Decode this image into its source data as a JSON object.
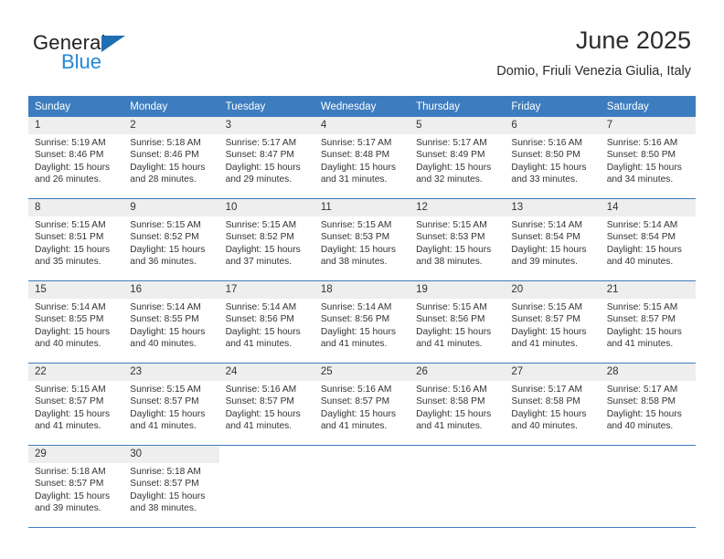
{
  "logo": {
    "word_one": "General",
    "word_two": "Blue",
    "triangle_icon": "triangle-icon",
    "brand_blue": "#2388d6",
    "brand_dark_blue": "#1f6fb4"
  },
  "header": {
    "title": "June 2025",
    "location": "Domio, Friuli Venezia Giulia, Italy"
  },
  "theme": {
    "header_bg": "#3d7dbf",
    "daynum_bg": "#eeeeee",
    "text": "#333333"
  },
  "calendar": {
    "weekdays": [
      "Sunday",
      "Monday",
      "Tuesday",
      "Wednesday",
      "Thursday",
      "Friday",
      "Saturday"
    ],
    "labels": {
      "sunrise": "Sunrise:",
      "sunset": "Sunset:",
      "daylight": "Daylight:"
    },
    "weeks": [
      [
        {
          "day": "1",
          "sunrise": "Sunrise: 5:19 AM",
          "sunset": "Sunset: 8:46 PM",
          "daylight": "Daylight: 15 hours and 26 minutes."
        },
        {
          "day": "2",
          "sunrise": "Sunrise: 5:18 AM",
          "sunset": "Sunset: 8:46 PM",
          "daylight": "Daylight: 15 hours and 28 minutes."
        },
        {
          "day": "3",
          "sunrise": "Sunrise: 5:17 AM",
          "sunset": "Sunset: 8:47 PM",
          "daylight": "Daylight: 15 hours and 29 minutes."
        },
        {
          "day": "4",
          "sunrise": "Sunrise: 5:17 AM",
          "sunset": "Sunset: 8:48 PM",
          "daylight": "Daylight: 15 hours and 31 minutes."
        },
        {
          "day": "5",
          "sunrise": "Sunrise: 5:17 AM",
          "sunset": "Sunset: 8:49 PM",
          "daylight": "Daylight: 15 hours and 32 minutes."
        },
        {
          "day": "6",
          "sunrise": "Sunrise: 5:16 AM",
          "sunset": "Sunset: 8:50 PM",
          "daylight": "Daylight: 15 hours and 33 minutes."
        },
        {
          "day": "7",
          "sunrise": "Sunrise: 5:16 AM",
          "sunset": "Sunset: 8:50 PM",
          "daylight": "Daylight: 15 hours and 34 minutes."
        }
      ],
      [
        {
          "day": "8",
          "sunrise": "Sunrise: 5:15 AM",
          "sunset": "Sunset: 8:51 PM",
          "daylight": "Daylight: 15 hours and 35 minutes."
        },
        {
          "day": "9",
          "sunrise": "Sunrise: 5:15 AM",
          "sunset": "Sunset: 8:52 PM",
          "daylight": "Daylight: 15 hours and 36 minutes."
        },
        {
          "day": "10",
          "sunrise": "Sunrise: 5:15 AM",
          "sunset": "Sunset: 8:52 PM",
          "daylight": "Daylight: 15 hours and 37 minutes."
        },
        {
          "day": "11",
          "sunrise": "Sunrise: 5:15 AM",
          "sunset": "Sunset: 8:53 PM",
          "daylight": "Daylight: 15 hours and 38 minutes."
        },
        {
          "day": "12",
          "sunrise": "Sunrise: 5:15 AM",
          "sunset": "Sunset: 8:53 PM",
          "daylight": "Daylight: 15 hours and 38 minutes."
        },
        {
          "day": "13",
          "sunrise": "Sunrise: 5:14 AM",
          "sunset": "Sunset: 8:54 PM",
          "daylight": "Daylight: 15 hours and 39 minutes."
        },
        {
          "day": "14",
          "sunrise": "Sunrise: 5:14 AM",
          "sunset": "Sunset: 8:54 PM",
          "daylight": "Daylight: 15 hours and 40 minutes."
        }
      ],
      [
        {
          "day": "15",
          "sunrise": "Sunrise: 5:14 AM",
          "sunset": "Sunset: 8:55 PM",
          "daylight": "Daylight: 15 hours and 40 minutes."
        },
        {
          "day": "16",
          "sunrise": "Sunrise: 5:14 AM",
          "sunset": "Sunset: 8:55 PM",
          "daylight": "Daylight: 15 hours and 40 minutes."
        },
        {
          "day": "17",
          "sunrise": "Sunrise: 5:14 AM",
          "sunset": "Sunset: 8:56 PM",
          "daylight": "Daylight: 15 hours and 41 minutes."
        },
        {
          "day": "18",
          "sunrise": "Sunrise: 5:14 AM",
          "sunset": "Sunset: 8:56 PM",
          "daylight": "Daylight: 15 hours and 41 minutes."
        },
        {
          "day": "19",
          "sunrise": "Sunrise: 5:15 AM",
          "sunset": "Sunset: 8:56 PM",
          "daylight": "Daylight: 15 hours and 41 minutes."
        },
        {
          "day": "20",
          "sunrise": "Sunrise: 5:15 AM",
          "sunset": "Sunset: 8:57 PM",
          "daylight": "Daylight: 15 hours and 41 minutes."
        },
        {
          "day": "21",
          "sunrise": "Sunrise: 5:15 AM",
          "sunset": "Sunset: 8:57 PM",
          "daylight": "Daylight: 15 hours and 41 minutes."
        }
      ],
      [
        {
          "day": "22",
          "sunrise": "Sunrise: 5:15 AM",
          "sunset": "Sunset: 8:57 PM",
          "daylight": "Daylight: 15 hours and 41 minutes."
        },
        {
          "day": "23",
          "sunrise": "Sunrise: 5:15 AM",
          "sunset": "Sunset: 8:57 PM",
          "daylight": "Daylight: 15 hours and 41 minutes."
        },
        {
          "day": "24",
          "sunrise": "Sunrise: 5:16 AM",
          "sunset": "Sunset: 8:57 PM",
          "daylight": "Daylight: 15 hours and 41 minutes."
        },
        {
          "day": "25",
          "sunrise": "Sunrise: 5:16 AM",
          "sunset": "Sunset: 8:57 PM",
          "daylight": "Daylight: 15 hours and 41 minutes."
        },
        {
          "day": "26",
          "sunrise": "Sunrise: 5:16 AM",
          "sunset": "Sunset: 8:58 PM",
          "daylight": "Daylight: 15 hours and 41 minutes."
        },
        {
          "day": "27",
          "sunrise": "Sunrise: 5:17 AM",
          "sunset": "Sunset: 8:58 PM",
          "daylight": "Daylight: 15 hours and 40 minutes."
        },
        {
          "day": "28",
          "sunrise": "Sunrise: 5:17 AM",
          "sunset": "Sunset: 8:58 PM",
          "daylight": "Daylight: 15 hours and 40 minutes."
        }
      ],
      [
        {
          "day": "29",
          "sunrise": "Sunrise: 5:18 AM",
          "sunset": "Sunset: 8:57 PM",
          "daylight": "Daylight: 15 hours and 39 minutes."
        },
        {
          "day": "30",
          "sunrise": "Sunrise: 5:18 AM",
          "sunset": "Sunset: 8:57 PM",
          "daylight": "Daylight: 15 hours and 38 minutes."
        },
        {
          "day": "",
          "sunrise": "",
          "sunset": "",
          "daylight": ""
        },
        {
          "day": "",
          "sunrise": "",
          "sunset": "",
          "daylight": ""
        },
        {
          "day": "",
          "sunrise": "",
          "sunset": "",
          "daylight": ""
        },
        {
          "day": "",
          "sunrise": "",
          "sunset": "",
          "daylight": ""
        },
        {
          "day": "",
          "sunrise": "",
          "sunset": "",
          "daylight": ""
        }
      ]
    ]
  }
}
